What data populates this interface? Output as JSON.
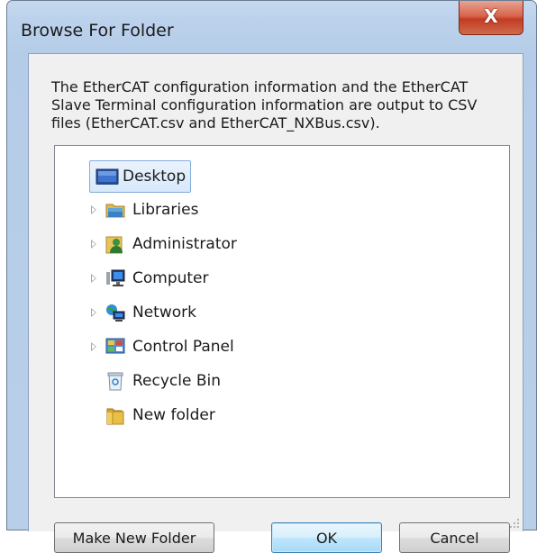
{
  "window": {
    "title": "Browse For Folder",
    "close_symbol": "X"
  },
  "instructions": "The EtherCAT configuration information and the EtherCAT Slave Terminal configuration information are output to CSV files (EtherCAT.csv and EtherCAT_NXBus.csv).",
  "tree": {
    "items": [
      {
        "label": "Desktop",
        "icon": "desktop-icon",
        "expandable": false,
        "selected": true
      },
      {
        "label": "Libraries",
        "icon": "libraries-icon",
        "expandable": true
      },
      {
        "label": "Administrator",
        "icon": "user-folder-icon",
        "expandable": true
      },
      {
        "label": "Computer",
        "icon": "computer-icon",
        "expandable": true
      },
      {
        "label": "Network",
        "icon": "network-icon",
        "expandable": true
      },
      {
        "label": "Control Panel",
        "icon": "control-panel-icon",
        "expandable": true
      },
      {
        "label": "Recycle Bin",
        "icon": "recycle-bin-icon",
        "expandable": false
      },
      {
        "label": "New folder",
        "icon": "folder-icon",
        "expandable": false
      }
    ]
  },
  "buttons": {
    "make_new_folder": "Make New Folder",
    "ok": "OK",
    "cancel": "Cancel"
  },
  "colors": {
    "frame": "#b9cfe9",
    "close_button": "#c23c22",
    "selection": "#d6e9fb",
    "default_button": "#bee6fd"
  }
}
